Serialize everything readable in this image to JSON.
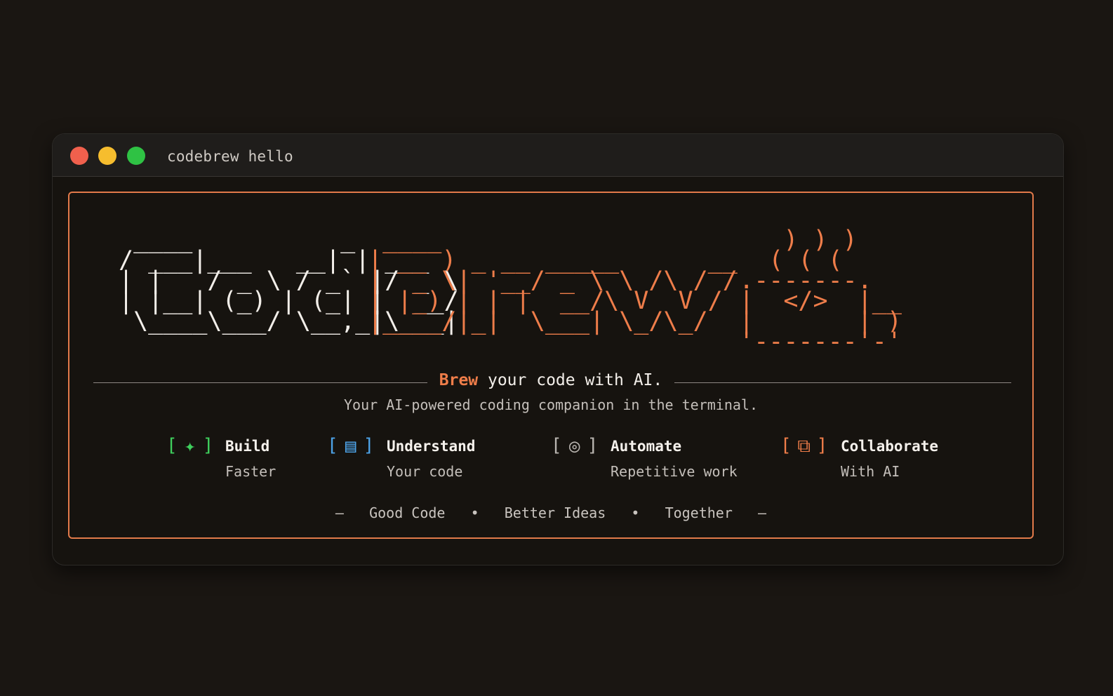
{
  "window": {
    "title": "codebrew hello"
  },
  "banner": {
    "code_art": " ____          _      \n/ ___|___   __| | ___ \n| |   / _ \\ / _` |/ _ \\\n| |__| (_) | (_| |  __/\n \\____\\___/ \\__,_|\\___|",
    "brew_art": " ____                    \n| __ ) _ __ _____      __\n|  _ \\| '__/ _ \\ \\ /\\ / /\n| |_) | | |  __/\\ V  V / \n|____/|_|  \\___| \\_/\\_/  ",
    "mug_art": "     ) ) )\n    ( ( (\n  .-------.\n  |  </>  |__\n  |       | )\n  '-------'-'",
    "tagline_accent": "Brew",
    "tagline_rest": " your code with AI.",
    "subtitle": "Your AI-powered coding companion in the terminal."
  },
  "features": [
    {
      "icon": "sparkle-icon",
      "glyph": "✦",
      "color": "#3fcf5d",
      "name": "Build",
      "sub": "Faster"
    },
    {
      "icon": "document-icon",
      "glyph": "▤",
      "color": "#4da3e8",
      "name": "Understand",
      "sub": "Your code"
    },
    {
      "icon": "target-icon",
      "glyph": "◎",
      "color": "#b9b5b0",
      "name": "Automate",
      "sub": "Repetitive work"
    },
    {
      "icon": "overlap-squares-icon",
      "glyph": "⧉",
      "color": "#ef7d49",
      "name": "Collaborate",
      "sub": "With AI"
    }
  ],
  "footer": {
    "dash": "–",
    "items": [
      "Good Code",
      "Better Ideas",
      "Together"
    ],
    "bullet": "•"
  },
  "colors": {
    "accent": "#ef7d49",
    "background": "#1a1612",
    "window_close": "#f0604d",
    "window_minimize": "#f6bd2e",
    "window_maximize": "#2fc244"
  }
}
